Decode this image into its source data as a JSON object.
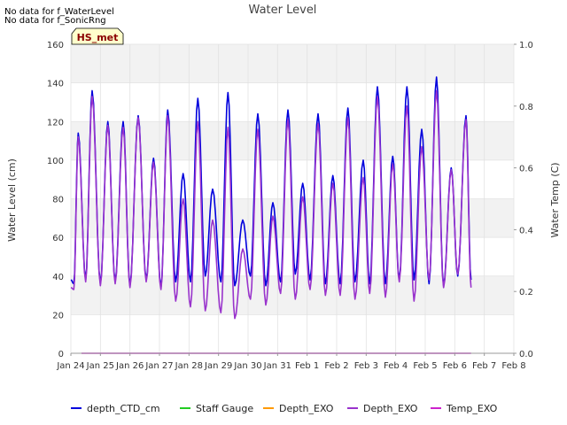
{
  "notes": [
    "No data for f_WaterLevel",
    "No data for f_SonicRng"
  ],
  "badge": "HS_met",
  "colors": {
    "depth_CTD_cm": "#0000dd",
    "Staff_Gauge": "#22cc22",
    "Depth_EXO_orange": "#ff9900",
    "Depth_EXO_purple": "#9933cc",
    "Temp_EXO": "#cc22cc",
    "band": "#f2f2f2",
    "badge_bg": "#ffffcc",
    "badge_text": "#8b0000"
  },
  "chart_data": {
    "type": "line",
    "title": "Water Level",
    "ylabel": "Water Level (cm)",
    "y2label": "Water Temp (C)",
    "ylim": [
      0,
      160
    ],
    "y2lim": [
      0.0,
      1.0
    ],
    "yticks": [
      "0",
      "20",
      "40",
      "60",
      "80",
      "100",
      "120",
      "140",
      "160"
    ],
    "y2ticks": [
      "0.0",
      "0.2",
      "0.4",
      "0.6",
      "0.8",
      "1.0"
    ],
    "xticks": [
      "Jan 24",
      "Jan 25",
      "Jan 26",
      "Jan 27",
      "Jan 28",
      "Jan 29",
      "Jan 30",
      "Jan 31",
      "Feb 1",
      "Feb 2",
      "Feb 3",
      "Feb 4",
      "Feb 5",
      "Feb 6",
      "Feb 7",
      "Feb 8"
    ],
    "xlim_days": [
      0,
      15
    ],
    "grid": true,
    "legend_position": "bottom",
    "series": [
      {
        "name": "depth_CTD_cm",
        "peaks": [
          {
            "day": 0.25,
            "value": 114
          },
          {
            "day": 0.72,
            "value": 136
          },
          {
            "day": 1.25,
            "value": 120
          },
          {
            "day": 1.77,
            "value": 120
          },
          {
            "day": 2.28,
            "value": 123
          },
          {
            "day": 2.8,
            "value": 101
          },
          {
            "day": 3.28,
            "value": 126
          },
          {
            "day": 3.8,
            "value": 93
          },
          {
            "day": 4.3,
            "value": 132
          },
          {
            "day": 4.8,
            "value": 85
          },
          {
            "day": 5.32,
            "value": 135
          },
          {
            "day": 5.82,
            "value": 69
          },
          {
            "day": 6.33,
            "value": 124
          },
          {
            "day": 6.84,
            "value": 78
          },
          {
            "day": 7.35,
            "value": 126
          },
          {
            "day": 7.85,
            "value": 88
          },
          {
            "day": 8.37,
            "value": 124
          },
          {
            "day": 8.87,
            "value": 92
          },
          {
            "day": 9.38,
            "value": 127
          },
          {
            "day": 9.9,
            "value": 100
          },
          {
            "day": 10.38,
            "value": 138
          },
          {
            "day": 10.9,
            "value": 102
          },
          {
            "day": 11.38,
            "value": 138
          },
          {
            "day": 11.88,
            "value": 116
          },
          {
            "day": 12.38,
            "value": 143
          },
          {
            "day": 12.88,
            "value": 96
          },
          {
            "day": 13.38,
            "value": 123
          }
        ],
        "troughs": [
          {
            "day": 0.0,
            "value": 38
          },
          {
            "day": 0.1,
            "value": 36
          },
          {
            "day": 0.5,
            "value": 38
          },
          {
            "day": 1.0,
            "value": 36
          },
          {
            "day": 1.5,
            "value": 37
          },
          {
            "day": 2.0,
            "value": 35
          },
          {
            "day": 2.55,
            "value": 38
          },
          {
            "day": 3.05,
            "value": 34
          },
          {
            "day": 3.55,
            "value": 37
          },
          {
            "day": 4.05,
            "value": 37
          },
          {
            "day": 4.55,
            "value": 40
          },
          {
            "day": 5.08,
            "value": 37
          },
          {
            "day": 5.55,
            "value": 35
          },
          {
            "day": 6.08,
            "value": 40
          },
          {
            "day": 6.6,
            "value": 35
          },
          {
            "day": 7.1,
            "value": 37
          },
          {
            "day": 7.6,
            "value": 41
          },
          {
            "day": 8.1,
            "value": 38
          },
          {
            "day": 8.62,
            "value": 36
          },
          {
            "day": 9.12,
            "value": 36
          },
          {
            "day": 9.62,
            "value": 37
          },
          {
            "day": 10.12,
            "value": 36
          },
          {
            "day": 10.65,
            "value": 36
          },
          {
            "day": 11.12,
            "value": 38
          },
          {
            "day": 11.62,
            "value": 38
          },
          {
            "day": 12.13,
            "value": 36
          },
          {
            "day": 12.62,
            "value": 35
          },
          {
            "day": 13.1,
            "value": 40
          },
          {
            "day": 13.55,
            "value": 38
          }
        ]
      },
      {
        "name": "Staff Gauge",
        "values": []
      },
      {
        "name": "Depth_EXO",
        "values": []
      },
      {
        "name": "Depth_EXO",
        "peaks": [
          {
            "day": 0.25,
            "value": 112
          },
          {
            "day": 0.72,
            "value": 133
          },
          {
            "day": 1.25,
            "value": 118
          },
          {
            "day": 1.77,
            "value": 117
          },
          {
            "day": 2.28,
            "value": 122
          },
          {
            "day": 2.8,
            "value": 99
          },
          {
            "day": 3.28,
            "value": 123
          },
          {
            "day": 3.8,
            "value": 80
          },
          {
            "day": 4.3,
            "value": 120
          },
          {
            "day": 4.8,
            "value": 69
          },
          {
            "day": 5.32,
            "value": 117
          },
          {
            "day": 5.82,
            "value": 54
          },
          {
            "day": 6.33,
            "value": 116
          },
          {
            "day": 6.84,
            "value": 71
          },
          {
            "day": 7.35,
            "value": 121
          },
          {
            "day": 7.85,
            "value": 81
          },
          {
            "day": 8.37,
            "value": 119
          },
          {
            "day": 8.87,
            "value": 88
          },
          {
            "day": 9.38,
            "value": 122
          },
          {
            "day": 9.9,
            "value": 91
          },
          {
            "day": 10.38,
            "value": 133
          },
          {
            "day": 10.9,
            "value": 98
          },
          {
            "day": 11.38,
            "value": 128
          },
          {
            "day": 11.88,
            "value": 107
          },
          {
            "day": 12.38,
            "value": 136
          },
          {
            "day": 12.88,
            "value": 95
          },
          {
            "day": 13.38,
            "value": 121
          }
        ],
        "troughs": [
          {
            "day": 0.0,
            "value": 34
          },
          {
            "day": 0.1,
            "value": 33
          },
          {
            "day": 0.5,
            "value": 37
          },
          {
            "day": 1.0,
            "value": 35
          },
          {
            "day": 1.5,
            "value": 36
          },
          {
            "day": 2.0,
            "value": 34
          },
          {
            "day": 2.55,
            "value": 37
          },
          {
            "day": 3.05,
            "value": 33
          },
          {
            "day": 3.55,
            "value": 27
          },
          {
            "day": 4.05,
            "value": 24
          },
          {
            "day": 4.55,
            "value": 22
          },
          {
            "day": 5.08,
            "value": 21
          },
          {
            "day": 5.55,
            "value": 18
          },
          {
            "day": 6.08,
            "value": 28
          },
          {
            "day": 6.6,
            "value": 25
          },
          {
            "day": 7.1,
            "value": 31
          },
          {
            "day": 7.6,
            "value": 28
          },
          {
            "day": 8.1,
            "value": 33
          },
          {
            "day": 8.62,
            "value": 30
          },
          {
            "day": 9.12,
            "value": 30
          },
          {
            "day": 9.62,
            "value": 28
          },
          {
            "day": 10.12,
            "value": 31
          },
          {
            "day": 10.65,
            "value": 29
          },
          {
            "day": 11.12,
            "value": 37
          },
          {
            "day": 11.62,
            "value": 27
          },
          {
            "day": 12.13,
            "value": 38
          },
          {
            "day": 12.62,
            "value": 34
          },
          {
            "day": 13.1,
            "value": 41
          },
          {
            "day": 13.55,
            "value": 34
          }
        ]
      },
      {
        "name": "Temp_EXO",
        "x_days": [
          0,
          13.55
        ],
        "values": [
          0.0,
          0.0
        ]
      }
    ]
  }
}
